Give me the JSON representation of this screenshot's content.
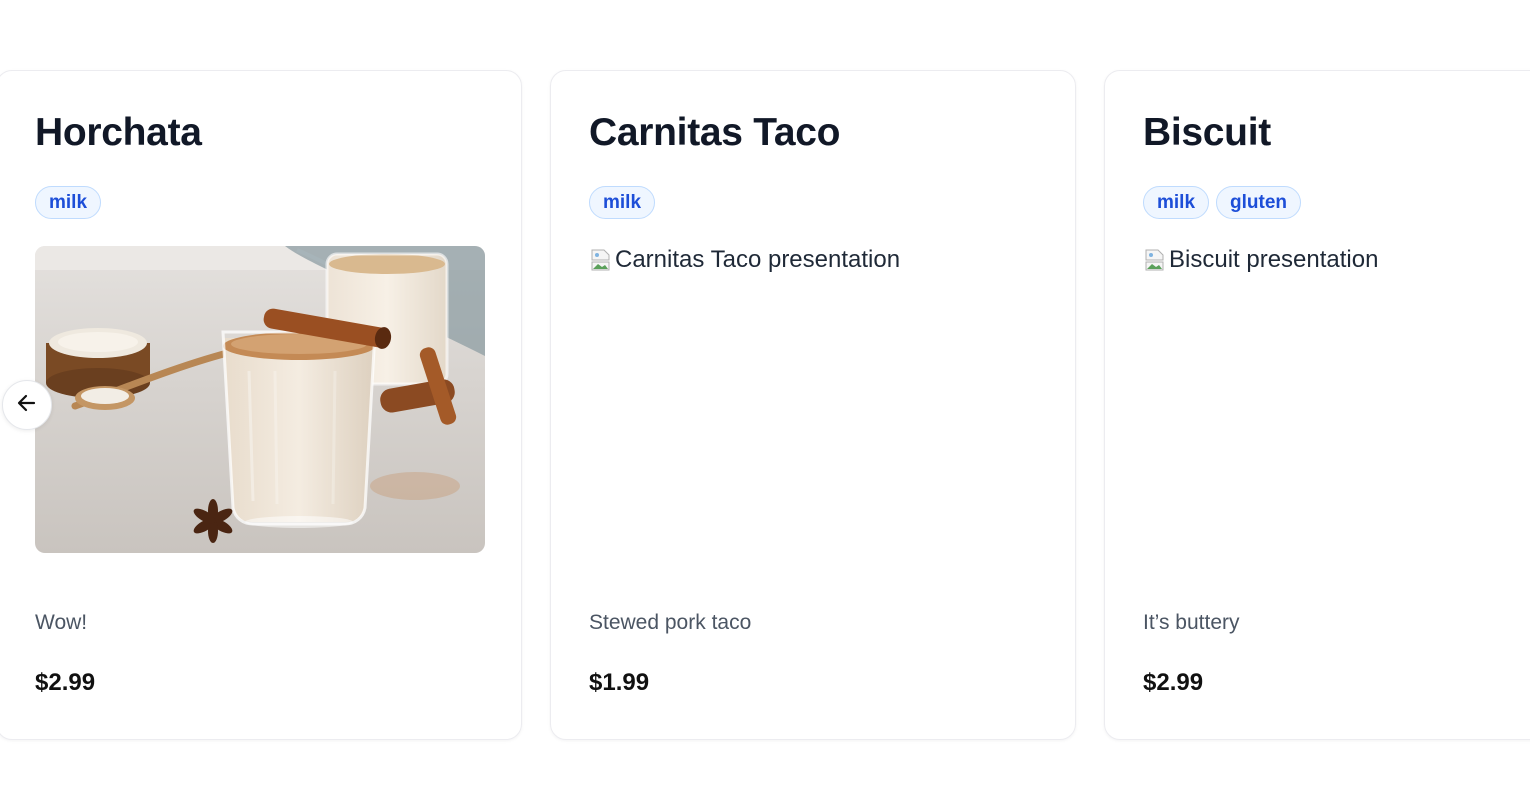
{
  "carousel": {
    "prev_icon": "arrow-left-icon",
    "cards": [
      {
        "title": "Horchata",
        "tags": [
          "milk"
        ],
        "image_alt": "",
        "image_loaded": true,
        "description": "Wow!",
        "price": "$2.99"
      },
      {
        "title": "Carnitas Taco",
        "tags": [
          "milk"
        ],
        "image_alt": "Carnitas Taco presentation",
        "image_loaded": false,
        "description": "Stewed pork taco",
        "price": "$1.99"
      },
      {
        "title": "Biscuit",
        "tags": [
          "milk",
          "gluten"
        ],
        "image_alt": "Biscuit presentation",
        "image_loaded": false,
        "description": "It’s buttery",
        "price": "$2.99"
      }
    ]
  },
  "colors": {
    "title": "#111827",
    "tag_text": "#1d4ed8",
    "tag_bg": "#eff6ff",
    "tag_border": "#bfdbfe",
    "description": "#4b5563",
    "price": "#111111",
    "card_border": "#ececf0"
  }
}
